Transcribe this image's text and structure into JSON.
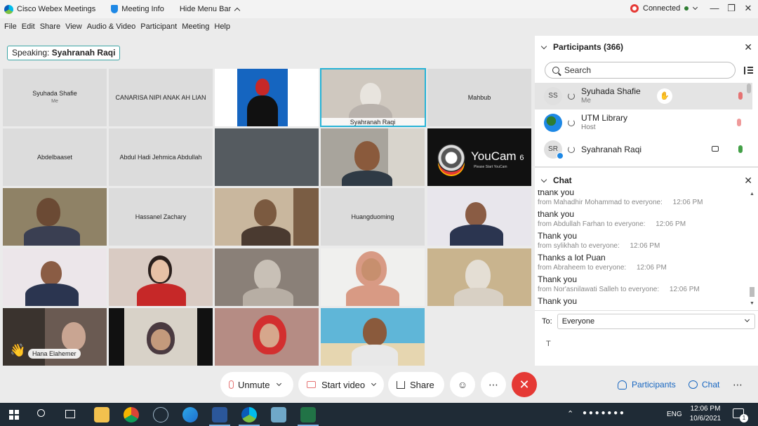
{
  "titlebar": {
    "app_name": "Cisco Webex Meetings",
    "meeting_info": "Meeting Info",
    "hide_menu": "Hide Menu Bar",
    "connection_status": "Connected"
  },
  "menu": [
    "File",
    "Edit",
    "Share",
    "View",
    "Audio & Video",
    "Participant",
    "Meeting",
    "Help"
  ],
  "speaking": {
    "prefix": "Speaking:",
    "name": "Syahranah Raqi"
  },
  "tiles": {
    "t1": {
      "name": "Syuhada Shafie",
      "sub": "Me"
    },
    "t2": {
      "name": "CANARISA NIPI ANAK AH LIAN"
    },
    "t4": {
      "name": "Syahranah Raqi"
    },
    "t5": {
      "name": "Mahbub"
    },
    "t6": {
      "name": "Abdelbaaset"
    },
    "t7": {
      "name": "Abdul Hadi Jehmica Abdullah"
    },
    "t10": {
      "title": "YouCam",
      "version": "6",
      "sub": "Please Start YouCam"
    },
    "t12": {
      "name": "Hassanel Zachary"
    },
    "t14": {
      "name": "Huangduoming"
    },
    "t21": {
      "name": "Hana Elahemer"
    }
  },
  "participants": {
    "title": "Participants (366)",
    "search_placeholder": "Search",
    "rows": [
      {
        "initials": "SS",
        "name": "Syuhada Shafie",
        "role": "Me"
      },
      {
        "initials": "",
        "name": "UTM Library",
        "role": "Host"
      },
      {
        "initials": "SR",
        "name": "Syahranah Raqi",
        "role": ""
      }
    ]
  },
  "chat": {
    "title": "Chat",
    "lines": [
      {
        "kind": "msg",
        "text": "thank you"
      },
      {
        "kind": "from",
        "text": "from Mahadhir Mohammad to everyone:",
        "time": "12:06 PM"
      },
      {
        "kind": "msg",
        "text": "thank you"
      },
      {
        "kind": "from",
        "text": "from Abdullah Farhan to everyone:",
        "time": "12:06 PM"
      },
      {
        "kind": "msg",
        "text": "Thank you"
      },
      {
        "kind": "from",
        "text": "from sylikhah to everyone:",
        "time": "12:06 PM"
      },
      {
        "kind": "msg",
        "text": "Thanks a lot Puan"
      },
      {
        "kind": "from",
        "text": "from Abraheem to everyone:",
        "time": "12:06 PM"
      },
      {
        "kind": "msg",
        "text": "Thank you"
      },
      {
        "kind": "from",
        "text": "from Nor'asnilawati Salleh to everyone:",
        "time": "12:06 PM"
      },
      {
        "kind": "msg",
        "text": "Thank you"
      }
    ],
    "to_label": "To:",
    "to_value": "Everyone",
    "input_placeholder": "T"
  },
  "toolbar": {
    "unmute": "Unmute",
    "start_video": "Start video",
    "share": "Share",
    "participants": "Participants",
    "chat": "Chat"
  },
  "taskbar": {
    "lang": "ENG",
    "time": "12:06 PM",
    "date": "10/6/2021",
    "notif_count": "1"
  },
  "colors": {
    "accent": "#26b3d6",
    "end_call": "#e53935",
    "mic_muted": "#e57373",
    "mic_active": "#43a047"
  }
}
